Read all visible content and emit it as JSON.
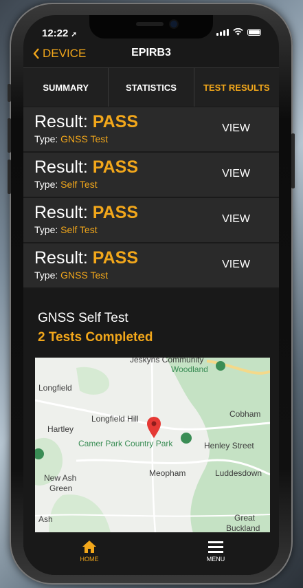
{
  "status": {
    "time": "12:22"
  },
  "nav": {
    "back_label": "DEVICE",
    "title": "EPIRB3"
  },
  "tabs": [
    {
      "label": "SUMMARY",
      "active": false
    },
    {
      "label": "STATISTICS",
      "active": false
    },
    {
      "label": "TEST RESULTS",
      "active": true
    }
  ],
  "results": [
    {
      "result_label": "Result:",
      "result_value": "PASS",
      "type_label": "Type:",
      "type_value": "GNSS Test",
      "action": "VIEW"
    },
    {
      "result_label": "Result:",
      "result_value": "PASS",
      "type_label": "Type:",
      "type_value": "Self Test",
      "action": "VIEW"
    },
    {
      "result_label": "Result:",
      "result_value": "PASS",
      "type_label": "Type:",
      "type_value": "Self Test",
      "action": "VIEW"
    },
    {
      "result_label": "Result:",
      "result_value": "PASS",
      "type_label": "Type:",
      "type_value": "GNSS Test",
      "action": "VIEW"
    }
  ],
  "summary": {
    "title": "GNSS Self Test",
    "count": "2 Tests Completed"
  },
  "map": {
    "labels": {
      "jeskyns": "Jeskyns Community",
      "woodland": "Woodland",
      "longfield": "Longfield",
      "cobham": "Cobham",
      "longfield_hill": "Longfield Hill",
      "hartley": "Hartley",
      "camer_park": "Camer Park Country Park",
      "henley_street": "Henley Street",
      "meopham": "Meopham",
      "luddesdown": "Luddesdown",
      "new_ash": "New Ash",
      "green": "Green",
      "ash": "Ash",
      "great": "Great",
      "buckland": "Buckland"
    }
  },
  "tabbar": {
    "home_label": "HOME",
    "menu_label": "MENU"
  },
  "colors": {
    "accent": "#f2a71b",
    "background": "#191919",
    "row": "#2a2a2a"
  }
}
